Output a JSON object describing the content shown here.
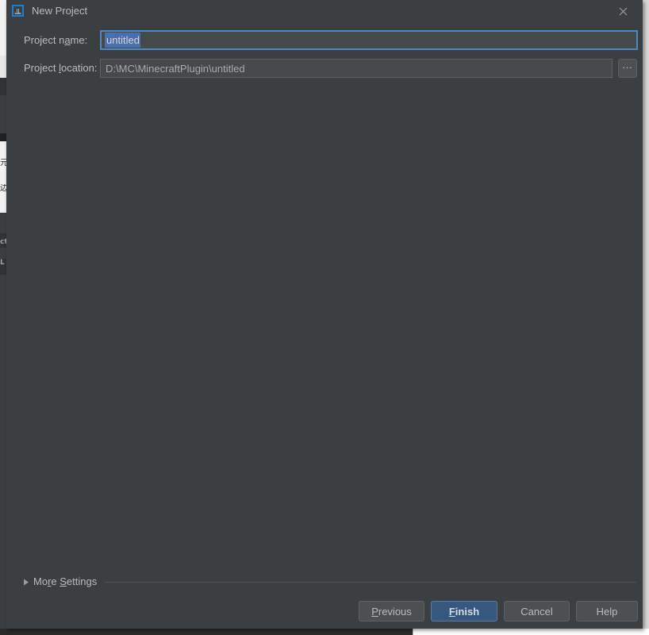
{
  "window": {
    "title": "New Project",
    "icon": "intellij-idea-icon",
    "close_icon": "close-icon",
    "accent_color": "#4a88c7",
    "background_color": "#3c3f41",
    "selection_color": "#4b6eaf",
    "default_button_color": "#365880"
  },
  "form": {
    "project_name": {
      "label": "Project n",
      "label_mnemonic": "a",
      "label_rest": "me:",
      "value": "untitled",
      "selected": true
    },
    "project_location": {
      "label": "Project ",
      "label_mnemonic": "l",
      "label_rest": "ocation:",
      "value": "D:\\MC\\MinecraftPlugin\\untitled",
      "browse_label": "...",
      "browse_icon": "ellipsis-icon"
    }
  },
  "more_settings": {
    "label_prefix": "Mo",
    "label_mnemonic": "r",
    "label_rest": "e ",
    "label_word2_mnemonic": "S",
    "label_word2_rest": "ettings",
    "expanded": false,
    "arrow_icon": "chevron-right-icon"
  },
  "buttons": [
    {
      "name": "previous",
      "prefix": "",
      "mnemonic": "P",
      "rest": "revious",
      "default": false
    },
    {
      "name": "finish",
      "prefix": "",
      "mnemonic": "F",
      "rest": "inish",
      "default": true
    },
    {
      "name": "cancel",
      "prefix": "",
      "mnemonic": "",
      "rest": "Cancel",
      "default": false
    },
    {
      "name": "help",
      "prefix": "",
      "mnemonic": "",
      "rest": "Help",
      "default": false
    }
  ],
  "background": {
    "fragment_1": "元",
    "fragment_2": "边",
    "fragment_3": "ct",
    "fragment_4": "L"
  }
}
